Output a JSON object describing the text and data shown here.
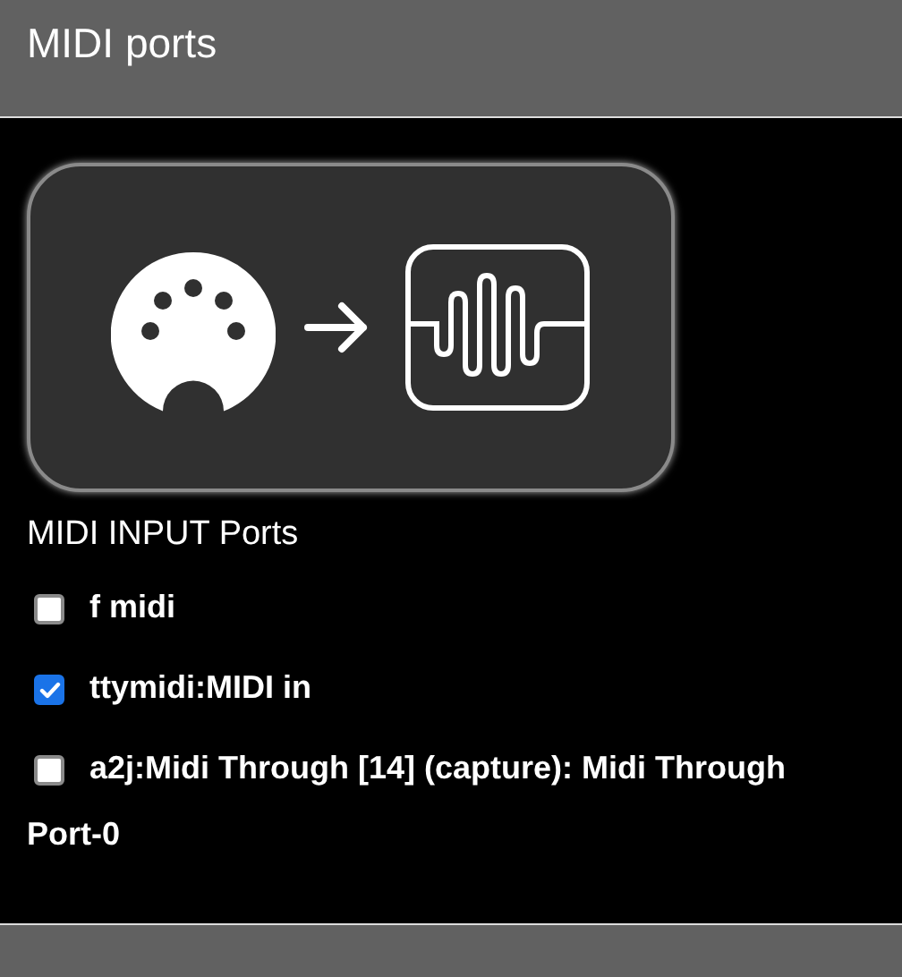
{
  "header": {
    "title": "MIDI ports"
  },
  "section": {
    "title": "MIDI INPUT Ports"
  },
  "ports": [
    {
      "label": "f midi",
      "checked": false
    },
    {
      "label": "ttymidi:MIDI in",
      "checked": true
    },
    {
      "label": "a2j:Midi Through [14] (capture): Midi Through Port-0",
      "checked": false
    }
  ]
}
